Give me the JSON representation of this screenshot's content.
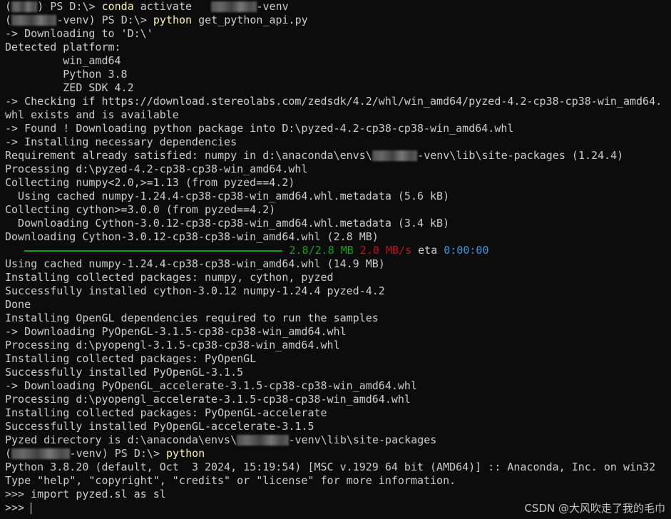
{
  "terminal": {
    "colors": {
      "background": "#0c0c0c",
      "default": "#cccccc",
      "command": "#f9f1a5",
      "green": "#13a10e",
      "red": "#c50f1f",
      "blue": "#3a96dd"
    },
    "lines": [
      {
        "segs": [
          {
            "t": "("
          },
          {
            "blur": 4
          },
          {
            "t": ") PS D:\\> "
          },
          {
            "t": "conda",
            "c": "yellow"
          },
          {
            "t": " activate   "
          },
          {
            "blur": 7
          },
          {
            "t": "-venv"
          }
        ]
      },
      {
        "segs": [
          {
            "t": "("
          },
          {
            "blur": 7
          },
          {
            "t": "-venv) PS D:\\> "
          },
          {
            "t": "python",
            "c": "yellow"
          },
          {
            "t": " get_python_api.py"
          }
        ]
      },
      {
        "segs": [
          {
            "t": "-> Downloading to 'D:\\'"
          }
        ]
      },
      {
        "segs": [
          {
            "t": "Detected platform:"
          }
        ]
      },
      {
        "segs": [
          {
            "t": "         win_amd64"
          }
        ]
      },
      {
        "segs": [
          {
            "t": "         Python 3.8"
          }
        ]
      },
      {
        "segs": [
          {
            "t": "         ZED SDK 4.2"
          }
        ]
      },
      {
        "segs": [
          {
            "t": "-> Checking if https://download.stereolabs.com/zedsdk/4.2/whl/win_amd64/pyzed-4.2-cp38-cp38-win_amd64."
          }
        ]
      },
      {
        "segs": [
          {
            "t": "whl exists and is available"
          }
        ]
      },
      {
        "segs": [
          {
            "t": "-> Found ! Downloading python package into D:\\pyzed-4.2-cp38-cp38-win_amd64.whl"
          }
        ]
      },
      {
        "segs": [
          {
            "t": "-> Installing necessary dependencies"
          }
        ]
      },
      {
        "segs": [
          {
            "t": "Requirement already satisfied: numpy in d:\\anaconda\\envs\\"
          },
          {
            "blur": 7
          },
          {
            "t": "-venv\\lib\\site-packages (1.24.4)"
          }
        ]
      },
      {
        "segs": [
          {
            "t": "Processing d:\\pyzed-4.2-cp38-cp38-win_amd64.whl"
          }
        ]
      },
      {
        "segs": [
          {
            "t": "Collecting numpy<2.0,>=1.13 (from pyzed==4.2)"
          }
        ]
      },
      {
        "segs": [
          {
            "t": "  Using cached numpy-1.24.4-cp38-cp38-win_amd64.whl.metadata (5.6 kB)"
          }
        ]
      },
      {
        "segs": [
          {
            "t": "Collecting cython>=3.0.0 (from pyzed==4.2)"
          }
        ]
      },
      {
        "segs": [
          {
            "t": "  Downloading Cython-3.0.12-cp38-cp38-win_amd64.whl.metadata (3.4 kB)"
          }
        ]
      },
      {
        "segs": [
          {
            "t": "Downloading Cython-3.0.12-cp38-cp38-win_amd64.whl (2.8 MB)"
          }
        ]
      },
      {
        "progress": true,
        "fraction": 1.0,
        "segs": [
          {
            "t": "   "
          },
          {
            "bar": 40
          },
          {
            "t": " "
          },
          {
            "t": "2.8/2.8 MB",
            "c": "green"
          },
          {
            "t": " "
          },
          {
            "t": "2.0 MB/s",
            "c": "red"
          },
          {
            "t": " eta "
          },
          {
            "t": "0:00:00",
            "c": "blue"
          }
        ]
      },
      {
        "segs": [
          {
            "t": "Using cached numpy-1.24.4-cp38-cp38-win_amd64.whl (14.9 MB)"
          }
        ]
      },
      {
        "segs": [
          {
            "t": "Installing collected packages: numpy, cython, pyzed"
          }
        ]
      },
      {
        "segs": [
          {
            "t": "Successfully installed cython-3.0.12 numpy-1.24.4 pyzed-4.2"
          }
        ]
      },
      {
        "segs": [
          {
            "t": "Done"
          }
        ]
      },
      {
        "segs": [
          {
            "t": "Installing OpenGL dependencies required to run the samples"
          }
        ]
      },
      {
        "segs": [
          {
            "t": "-> Downloading PyOpenGL-3.1.5-cp38-cp38-win_amd64.whl"
          }
        ]
      },
      {
        "segs": [
          {
            "t": "Processing d:\\pyopengl-3.1.5-cp38-cp38-win_amd64.whl"
          }
        ]
      },
      {
        "segs": [
          {
            "t": "Installing collected packages: PyOpenGL"
          }
        ]
      },
      {
        "segs": [
          {
            "t": "Successfully installed PyOpenGL-3.1.5"
          }
        ]
      },
      {
        "segs": [
          {
            "t": "-> Downloading PyOpenGL_accelerate-3.1.5-cp38-cp38-win_amd64.whl"
          }
        ]
      },
      {
        "segs": [
          {
            "t": "Processing d:\\pyopengl_accelerate-3.1.5-cp38-cp38-win_amd64.whl"
          }
        ]
      },
      {
        "segs": [
          {
            "t": "Installing collected packages: PyOpenGL-accelerate"
          }
        ]
      },
      {
        "segs": [
          {
            "t": "Successfully installed PyOpenGL-accelerate-3.1.5"
          }
        ]
      },
      {
        "segs": [
          {
            "t": "Pyzed directory is d:\\anaconda\\envs\\"
          },
          {
            "blur": 8
          },
          {
            "t": "-venv\\lib\\site-packages"
          }
        ]
      },
      {
        "segs": [
          {
            "t": "("
          },
          {
            "blur": 9
          },
          {
            "t": "-venv) PS D:\\> "
          },
          {
            "t": "python",
            "c": "yellow"
          }
        ]
      },
      {
        "segs": [
          {
            "t": "Python 3.8.20 (default, Oct  3 2024, 15:19:54) [MSC v.1929 64 bit (AMD64)] :: Anaconda, Inc. on win32"
          }
        ]
      },
      {
        "segs": [
          {
            "t": "Type \"help\", \"copyright\", \"credits\" or \"license\" for more information."
          }
        ]
      },
      {
        "segs": [
          {
            "t": ">>> import pyzed.sl as sl"
          }
        ]
      },
      {
        "segs": [
          {
            "t": ">>> "
          }
        ],
        "cursor": true
      }
    ]
  },
  "watermark": {
    "text": "CSDN @大风吹走了我的毛巾"
  }
}
